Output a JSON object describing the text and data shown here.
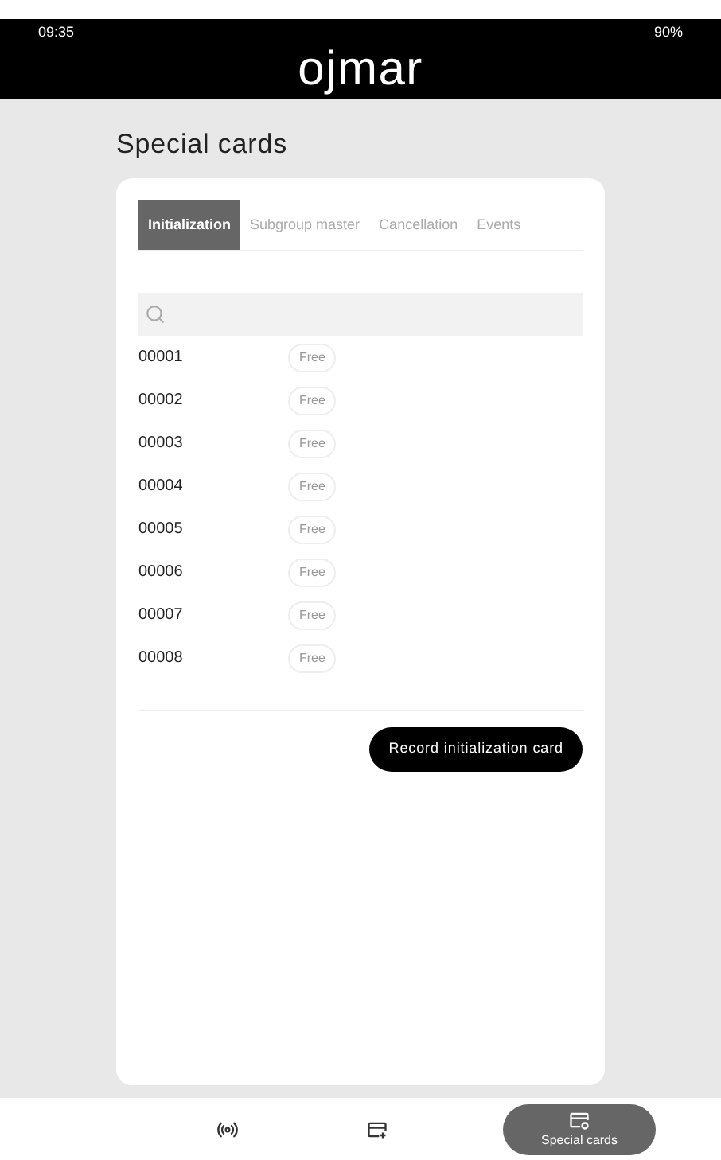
{
  "status_bar": {
    "time": "09:35",
    "battery": "90%"
  },
  "app_bar": {
    "logo": "ojmar"
  },
  "page": {
    "title": "Special cards"
  },
  "tabs": [
    {
      "label": "Initialization",
      "selected": true
    },
    {
      "label": "Subgroup master",
      "selected": false
    },
    {
      "label": "Cancellation",
      "selected": false
    },
    {
      "label": "Events",
      "selected": false
    }
  ],
  "cards": [
    {
      "number": "00001",
      "status": "Free"
    },
    {
      "number": "00002",
      "status": "Free"
    },
    {
      "number": "00003",
      "status": "Free"
    },
    {
      "number": "00004",
      "status": "Free"
    },
    {
      "number": "00005",
      "status": "Free"
    },
    {
      "number": "00006",
      "status": "Free"
    },
    {
      "number": "00007",
      "status": "Free"
    },
    {
      "number": "00008",
      "status": "Free"
    }
  ],
  "action_button": "Record initialization card",
  "bottom_nav": [
    {
      "kind": "signal",
      "selected": false
    },
    {
      "kind": "add-card",
      "selected": false
    },
    {
      "kind": "special",
      "label": "Special cards",
      "selected": true
    }
  ]
}
